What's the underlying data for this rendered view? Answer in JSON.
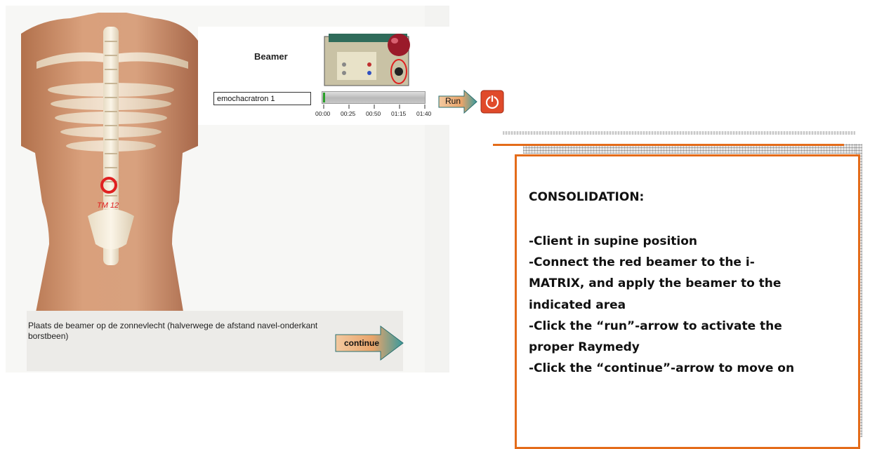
{
  "beamer": {
    "title": "Beamer",
    "program": "emochacratron 1",
    "progress": 0.02,
    "ticks": [
      "00:00",
      "00:25",
      "00:50",
      "01:15",
      "01:40"
    ],
    "run_label": "Run"
  },
  "figure": {
    "point_label": "TM 12"
  },
  "instruction": {
    "text": "Plaats de beamer op de zonnevlecht (halverwege de afstand navel-onderkant borstbeen)",
    "continue_label": "continue"
  },
  "consolidation": {
    "title": "CONSOLIDATION:",
    "items": [
      "-Client in supine position",
      "-Connect the red beamer to the  i-",
      "MATRIX, and apply the beamer to the",
      "indicated area",
      "-Click the  “run”-arrow to activate the",
      "proper Raymedy",
      "-Click the “continue”-arrow to move on"
    ]
  },
  "colors": {
    "accent_orange": "#e46c1a",
    "arrow_teal": "#3a9a9c",
    "power_red": "#e04a2a",
    "progress_green": "#2aa02a"
  }
}
